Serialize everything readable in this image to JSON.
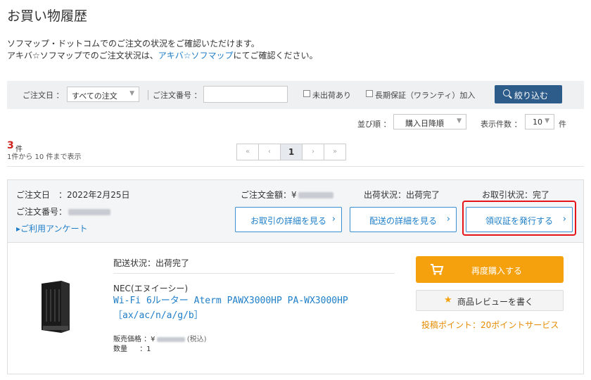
{
  "page_title": "お買い物履歴",
  "intro": {
    "line1": "ソフマップ・ドットコムでのご注文の状況をご確認いただけます。",
    "line2_before": "アキバ☆ソフマップでのご注文状況は、",
    "line2_link": "アキバ☆ソフマップ",
    "line2_after": "にてご確認ください。"
  },
  "filter": {
    "order_date_label": "ご注文日 ：",
    "order_date_value": "すべての注文",
    "order_number_label": "ご注文番号 ：",
    "order_number_value": "",
    "unshipped_label": "未出荷あり",
    "warranty_label": "長期保証（ワランティ）加入",
    "narrow_button": "絞り込む"
  },
  "sort": {
    "order_label": "並び順 ：",
    "order_value": "購入日降順",
    "per_page_label": "表示件数 ：",
    "per_page_value": "10",
    "per_page_unit": "件"
  },
  "results": {
    "count": "3",
    "count_unit": "件",
    "range_text": "1件から 10 件まで表示"
  },
  "pagination": {
    "first": "«",
    "prev": "‹",
    "current": "1",
    "next": "›",
    "last": "»"
  },
  "order": {
    "date_label": "ご注文日　：",
    "date_value": "2022年2月25日",
    "amount_label": "ご注文金額：¥",
    "shipping_label": "出荷状況：",
    "shipping_value": "出荷完了",
    "transaction_label": "お取引状況：",
    "transaction_value": "完了",
    "number_label": "ご注文番号：",
    "survey_link": "▸ご利用アンケート",
    "btn_transaction_detail": "お取引の詳細を見る",
    "btn_delivery_detail": "配送の詳細を見る",
    "btn_receipt": "領収証を発行する"
  },
  "item": {
    "delivery_status": "配送状況：出荷完了",
    "maker": "NEC(エヌイーシー)",
    "name": "Wi-Fi 6ルーター Aterm PAWX3000HP PA-WX3000HP ［ax/ac/n/a/g/b］",
    "price_label": "販売価格 ：¥",
    "tax_note": "(税込)",
    "qty_label": "数量",
    "qty_value": "：1",
    "rebuy_button": "再度購入する",
    "review_button": "商品レビューを書く",
    "points_text": "投稿ポイント：20ポイントサービス"
  },
  "colors": {
    "accent_blue": "#1e7ec8",
    "narrow_button": "#2d5b8a",
    "rebuy_orange": "#f5a10e",
    "highlight_red": "#e5141b",
    "count_red": "#d0201b"
  }
}
